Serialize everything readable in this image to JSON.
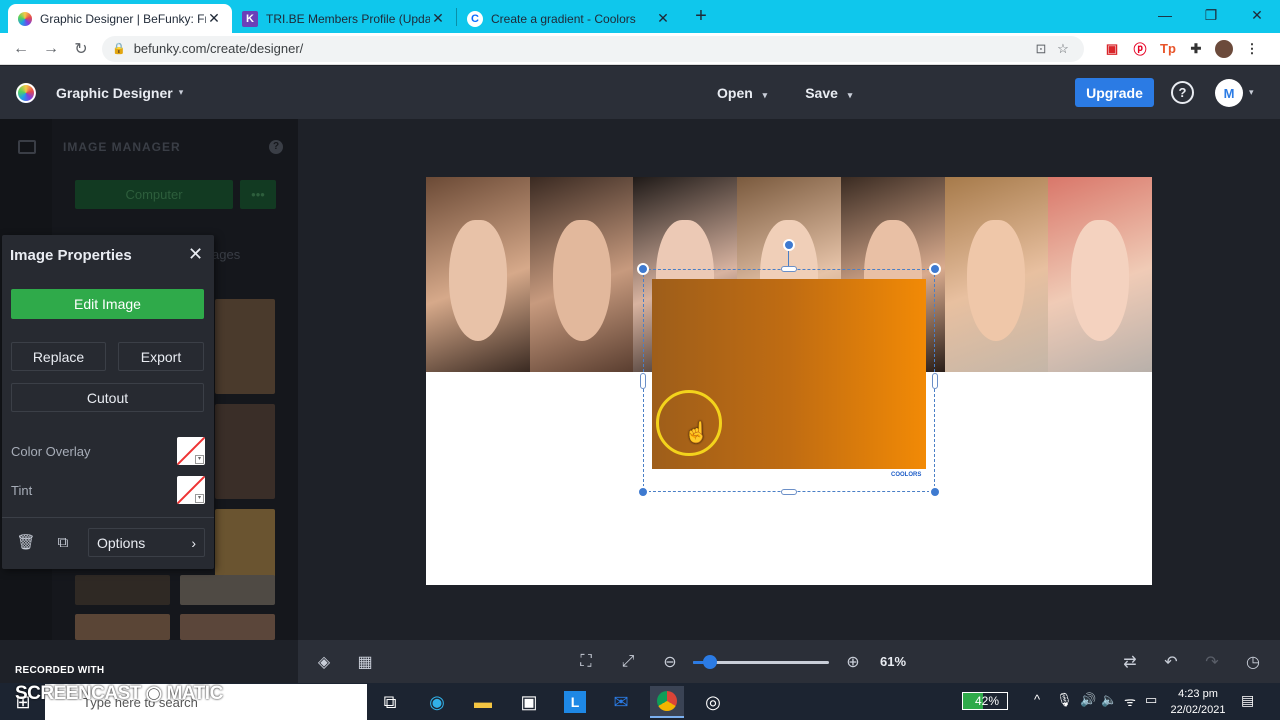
{
  "browser": {
    "tabs": [
      {
        "title": "Graphic Designer | BeFunky: Free",
        "icon": "befunky-favicon",
        "active": true
      },
      {
        "title": "TRI.BE Members Profile (Updated",
        "icon": "kprofiles-favicon",
        "active": false
      },
      {
        "title": "Create a gradient - Coolors",
        "icon": "coolors-favicon",
        "active": false
      }
    ],
    "url": "befunky.com/create/designer/"
  },
  "app": {
    "title": "Graphic Designer",
    "menu_open": "Open",
    "menu_save": "Save",
    "upgrade": "Upgrade",
    "help": "?",
    "avatar_initial": "M"
  },
  "image_manager": {
    "title": "IMAGE MANAGER",
    "computer_button": "Computer",
    "more_button": "•••",
    "ghost_text": "ages"
  },
  "image_properties": {
    "title": "Image Properties",
    "edit_image": "Edit Image",
    "replace": "Replace",
    "export": "Export",
    "cutout": "Cutout",
    "color_overlay": "Color Overlay",
    "tint": "Tint",
    "options": "Options"
  },
  "canvas": {
    "gradient_colors": [
      "#9e5e1a",
      "#c06c12",
      "#f28a05"
    ],
    "gradient_watermark": "COOLORS"
  },
  "bottom_toolbar": {
    "zoom_value": "61%",
    "zoom_level": 0.61
  },
  "watermark": {
    "small": "RECORDED WITH",
    "big": "SCREENCAST ◉ MATIC"
  },
  "taskbar": {
    "search_placeholder": "Type here to search",
    "battery": "42%",
    "time": "4:23 pm",
    "date": "22/02/2021"
  },
  "colors": {
    "accent_blue": "#2b7be4",
    "green": "#2faa4a",
    "tab_strip": "#0fc7ec"
  }
}
